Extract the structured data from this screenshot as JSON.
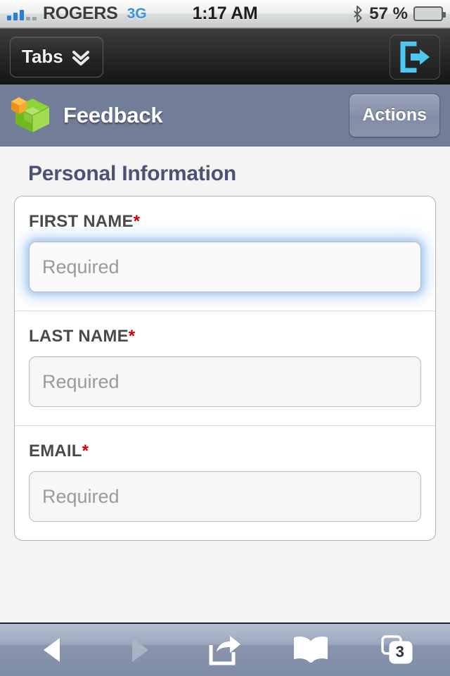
{
  "status_bar": {
    "carrier": "ROGERS",
    "network_type": "3G",
    "time": "1:17 AM",
    "battery_percent": "57 %",
    "battery_level": 57,
    "signal_bars_filled": 3,
    "signal_bars_total": 5,
    "bluetooth_icon": "bluetooth-icon",
    "battery_color": "#63c81d"
  },
  "browser_chrome": {
    "tabs_button_label": "Tabs",
    "tabs_chevron_icon": "double-chevron-down-icon",
    "exit_button_icon": "exit-app-icon",
    "exit_icon_color": "#4dc8f0"
  },
  "app_header": {
    "logo_icon": "green-cube-blocks-logo",
    "title": "Feedback",
    "actions_label": "Actions",
    "bar_color": "#717d99"
  },
  "form": {
    "section_title": "Personal Information",
    "required_marker": "*",
    "fields": [
      {
        "label": "FIRST NAME",
        "required": true,
        "value": "",
        "placeholder": "Required",
        "focused": true
      },
      {
        "label": "LAST NAME",
        "required": true,
        "value": "",
        "placeholder": "Required",
        "focused": false
      },
      {
        "label": "EMAIL",
        "required": true,
        "value": "",
        "placeholder": "Required",
        "focused": false
      }
    ]
  },
  "toolbar": {
    "back_icon": "back-arrow-icon",
    "forward_icon": "forward-arrow-icon",
    "forward_disabled": true,
    "share_icon": "share-icon",
    "bookmarks_icon": "bookmarks-book-icon",
    "tabs_icon": "tabs-stack-icon",
    "tabs_count": "3"
  }
}
